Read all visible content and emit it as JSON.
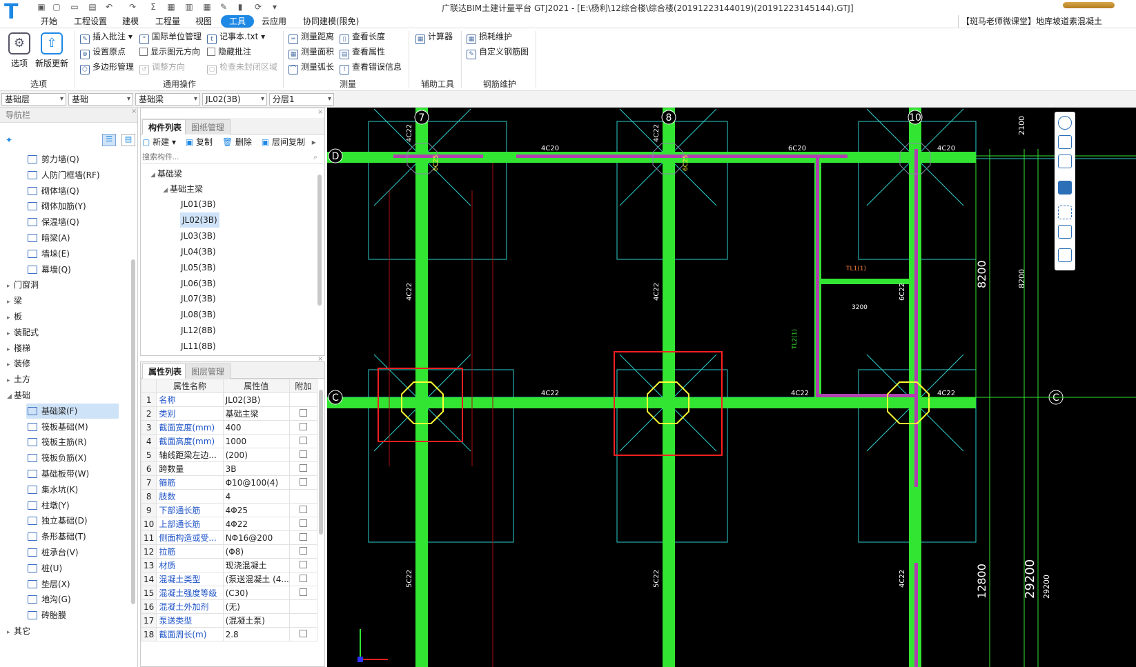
{
  "app": {
    "title": "广联达BIM土建计量平台 GTJ2021 - [E:\\杨利\\12综合楼\\综合楼(20191223144019)(20191223145144).GTJ]",
    "notice": "【斑马老师微课堂】地库坡道素混凝土"
  },
  "menu": [
    "开始",
    "工程设置",
    "建模",
    "工程量",
    "视图",
    "工具",
    "云应用",
    "协同建模(限免)"
  ],
  "menu_active": "工具",
  "ribbon": {
    "options_group": {
      "label": "选项",
      "buttons": [
        "选项",
        "新版更新"
      ]
    },
    "common_group": {
      "label": "通用操作",
      "buttons": [
        "插入批注",
        "国际单位管理",
        "记事本.txt",
        "设置原点",
        "显示图元方向",
        "隐藏批注",
        "多边形管理",
        "调整方向",
        "检查未封闭区域"
      ]
    },
    "measure_group": {
      "label": "测量",
      "buttons": [
        "测量距离",
        "查看长度",
        "测量面积",
        "查看属性",
        "测量弧长",
        "查看错误信息"
      ]
    },
    "aux_group": {
      "label": "辅助工具",
      "buttons": [
        "计算器"
      ]
    },
    "rebar_group": {
      "label": "钢筋维护",
      "buttons": [
        "损耗维护",
        "自定义钢筋图"
      ]
    }
  },
  "dropdowns": [
    "基础层",
    "基础",
    "基础梁",
    "JL02(3B)",
    "分层1"
  ],
  "nav": {
    "title": "导航栏",
    "items": [
      {
        "label": "剪力墙(Q)",
        "kind": "child"
      },
      {
        "label": "人防门框墙(RF)",
        "kind": "child"
      },
      {
        "label": "砌体墙(Q)",
        "kind": "child"
      },
      {
        "label": "砌体加筋(Y)",
        "kind": "child"
      },
      {
        "label": "保温墙(Q)",
        "kind": "child"
      },
      {
        "label": "暗梁(A)",
        "kind": "child"
      },
      {
        "label": "墙垛(E)",
        "kind": "child"
      },
      {
        "label": "幕墙(Q)",
        "kind": "child"
      },
      {
        "label": "门窗洞",
        "kind": "group"
      },
      {
        "label": "梁",
        "kind": "group"
      },
      {
        "label": "板",
        "kind": "group"
      },
      {
        "label": "装配式",
        "kind": "group"
      },
      {
        "label": "楼梯",
        "kind": "group"
      },
      {
        "label": "装修",
        "kind": "group"
      },
      {
        "label": "土方",
        "kind": "group"
      },
      {
        "label": "基础",
        "kind": "open"
      },
      {
        "label": "基础梁(F)",
        "kind": "child",
        "selected": true
      },
      {
        "label": "筏板基础(M)",
        "kind": "child"
      },
      {
        "label": "筏板主筋(R)",
        "kind": "child"
      },
      {
        "label": "筏板负筋(X)",
        "kind": "child"
      },
      {
        "label": "基础板带(W)",
        "kind": "child"
      },
      {
        "label": "集水坑(K)",
        "kind": "child"
      },
      {
        "label": "柱墩(Y)",
        "kind": "child"
      },
      {
        "label": "独立基础(D)",
        "kind": "child"
      },
      {
        "label": "条形基础(T)",
        "kind": "child"
      },
      {
        "label": "桩承台(V)",
        "kind": "child"
      },
      {
        "label": "桩(U)",
        "kind": "child"
      },
      {
        "label": "垫层(X)",
        "kind": "child"
      },
      {
        "label": "地沟(G)",
        "kind": "child"
      },
      {
        "label": "砖胎膜",
        "kind": "child"
      },
      {
        "label": "其它",
        "kind": "group"
      }
    ]
  },
  "components": {
    "tabs": [
      "构件列表",
      "图纸管理"
    ],
    "toolbar": [
      "新建",
      "复制",
      "删除",
      "层间复制"
    ],
    "search_placeholder": "搜索构件...",
    "tree_root": "基础梁",
    "tree_sub": "基础主梁",
    "items": [
      "JL01(3B)",
      "JL02(3B)",
      "JL03(3B)",
      "JL04(3B)",
      "JL05(3B)",
      "JL06(3B)",
      "JL07(3B)",
      "JL08(3B)",
      "JL12(8B)",
      "JL11(8B)"
    ],
    "selected": "JL02(3B)"
  },
  "properties": {
    "tabs": [
      "属性列表",
      "图层管理"
    ],
    "headers": [
      "属性名称",
      "属性值",
      "附加"
    ],
    "rows": [
      {
        "n": "1",
        "k": "名称",
        "v": "JL02(3B)",
        "blue": true,
        "chk": false
      },
      {
        "n": "2",
        "k": "类别",
        "v": "基础主梁",
        "blue": true,
        "chk": true
      },
      {
        "n": "3",
        "k": "截面宽度(mm)",
        "v": "400",
        "blue": true,
        "chk": true
      },
      {
        "n": "4",
        "k": "截面高度(mm)",
        "v": "1000",
        "blue": true,
        "chk": true
      },
      {
        "n": "5",
        "k": "轴线距梁左边...",
        "v": "(200)",
        "blue": false,
        "chk": true
      },
      {
        "n": "6",
        "k": "跨数量",
        "v": "3B",
        "blue": false,
        "chk": true
      },
      {
        "n": "7",
        "k": "箍筋",
        "v": "Φ10@100(4)",
        "blue": true,
        "chk": true
      },
      {
        "n": "8",
        "k": "肢数",
        "v": "4",
        "blue": true,
        "chk": false
      },
      {
        "n": "9",
        "k": "下部通长筋",
        "v": "4Φ25",
        "blue": true,
        "chk": true
      },
      {
        "n": "10",
        "k": "上部通长筋",
        "v": "4Φ22",
        "blue": true,
        "chk": true
      },
      {
        "n": "11",
        "k": "侧面构造或受...",
        "v": "NΦ16@200",
        "blue": true,
        "chk": true
      },
      {
        "n": "12",
        "k": "拉筋",
        "v": "(Φ8)",
        "blue": true,
        "chk": true
      },
      {
        "n": "13",
        "k": "材质",
        "v": "现浇混凝土",
        "blue": true,
        "chk": true
      },
      {
        "n": "14",
        "k": "混凝土类型",
        "v": "(泵送混凝土 (4...",
        "blue": true,
        "chk": true
      },
      {
        "n": "15",
        "k": "混凝土强度等级",
        "v": "(C30)",
        "blue": true,
        "chk": true
      },
      {
        "n": "16",
        "k": "混凝土外加剂",
        "v": "(无)",
        "blue": true,
        "chk": false
      },
      {
        "n": "17",
        "k": "泵送类型",
        "v": "(混凝土泵)",
        "blue": true,
        "chk": false
      },
      {
        "n": "18",
        "k": "截面周长(m)",
        "v": "2.8",
        "blue": true,
        "chk": true
      }
    ]
  },
  "drawing": {
    "axes_top": [
      "7",
      "8",
      "10"
    ],
    "axes_side": [
      "D",
      "C"
    ],
    "labels": [
      "4C22",
      "4C20",
      "6C20",
      "4C20",
      "6C25",
      "6C25",
      "4C20",
      "4C22",
      "4C22",
      "6C22",
      "TL1(1)",
      "3200",
      "TL2(1)",
      "4C22",
      "4C22",
      "4C22",
      "5C22",
      "5C22",
      "4C22",
      "8200",
      "8200",
      "2100",
      "12800",
      "29200",
      "29200",
      "JL02(3B)"
    ],
    "dims": [
      "8200",
      "12800",
      "29200"
    ],
    "colors": {
      "beam": "#33e533",
      "axis": "#2ed0d0",
      "column": "#ffff33",
      "highlight": "#ff2020",
      "purple": "#b040b0"
    }
  }
}
